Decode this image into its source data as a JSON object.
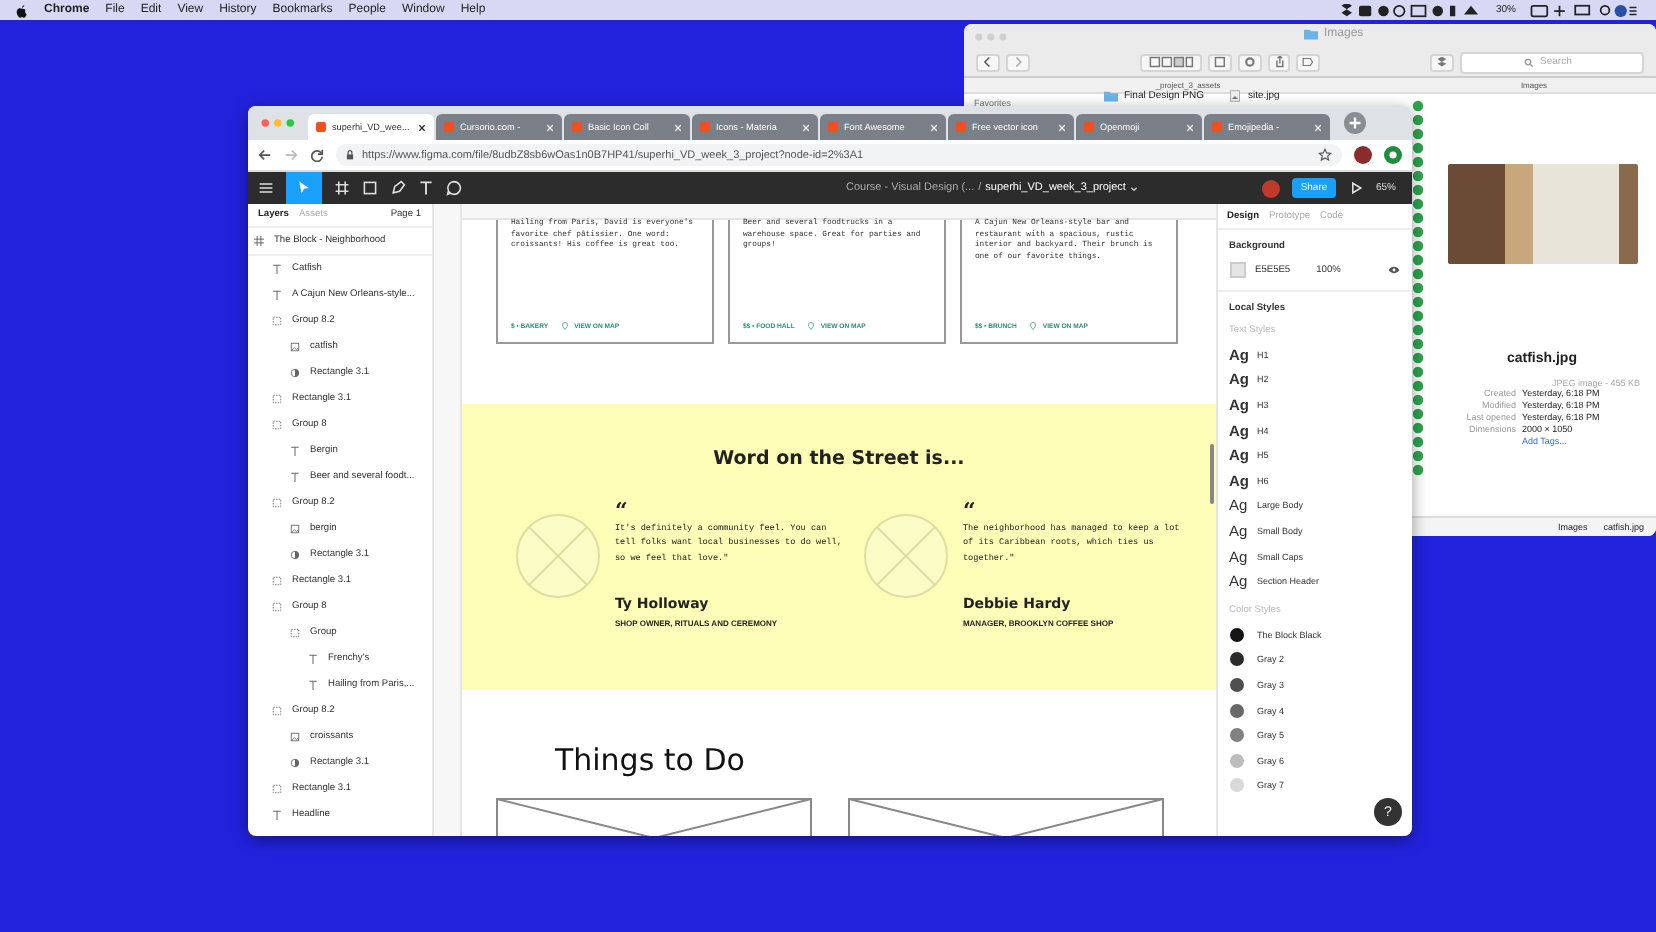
{
  "menubar": {
    "app": "Chrome",
    "items": [
      "File",
      "Edit",
      "View",
      "History",
      "Bookmarks",
      "People",
      "Window",
      "Help"
    ],
    "battery": "30%"
  },
  "finder": {
    "title": "Images",
    "search": {
      "placeholder": "Search"
    },
    "columns": [
      "_project_3_assets",
      "Images"
    ],
    "sidebar_heading": "Favorites",
    "rows": [
      {
        "name": "Final Design PNG",
        "kind": "folder"
      },
      {
        "name": "site.jpg",
        "kind": "file"
      }
    ],
    "preview": {
      "filename": "catfish.jpg",
      "type": "JPEG image - 455 KB",
      "meta": [
        {
          "label": "Created",
          "value": "Yesterday, 6:18 PM"
        },
        {
          "label": "Modified",
          "value": "Yesterday, 6:18 PM"
        },
        {
          "label": "Last opened",
          "value": "Yesterday, 6:18 PM"
        },
        {
          "label": "Dimensions",
          "value": "2000 × 1050"
        }
      ],
      "add_tags": "Add Tags..."
    },
    "path": [
      "Images",
      "catfish.jpg"
    ]
  },
  "browser": {
    "tabs": [
      {
        "title": "superhi_VD_wee...",
        "selected": true
      },
      {
        "title": "Cursorio.com -",
        "selected": false
      },
      {
        "title": "Basic Icon Coll",
        "selected": false
      },
      {
        "title": "Icons - Materia",
        "selected": false
      },
      {
        "title": "Font Awesome",
        "selected": false
      },
      {
        "title": "Free vector icon",
        "selected": false
      },
      {
        "title": "Openmoji",
        "selected": false
      },
      {
        "title": "Emojipedia -",
        "selected": false
      }
    ],
    "url": "https://www.figma.com/file/8udbZ8sb6wOas1n0B7HP41/superhi_VD_week_3_project?node-id=2%3A1"
  },
  "figma": {
    "breadcrumb": "Course - Visual Design (...",
    "separator": "/",
    "file": "superhi_VD_week_3_project",
    "share": "Share",
    "zoom": "65%",
    "layer_tabs": [
      {
        "label": "Layers",
        "selected": true
      },
      {
        "label": "Assets",
        "selected": false
      }
    ],
    "page": "Page 1",
    "frame": "The Block - Neighborhood",
    "layers": [
      {
        "name": "Catfish",
        "kind": "text"
      },
      {
        "name": "A Cajun New Orleans-style...",
        "kind": "text"
      },
      {
        "name": "Group 8.2",
        "kind": "group",
        "children": [
          {
            "name": "catfish",
            "kind": "image"
          },
          {
            "name": "Rectangle 3.1",
            "kind": "mask"
          }
        ]
      },
      {
        "name": "Rectangle 3.1",
        "kind": "group"
      },
      {
        "name": "Group 8",
        "kind": "group",
        "children": [
          {
            "name": "Bergin",
            "kind": "text"
          },
          {
            "name": "Beer and several foodt...",
            "kind": "text"
          }
        ]
      },
      {
        "name": "Group 8.2",
        "kind": "group",
        "children": [
          {
            "name": "bergin",
            "kind": "image"
          },
          {
            "name": "Rectangle 3.1",
            "kind": "mask"
          }
        ]
      },
      {
        "name": "Rectangle 3.1",
        "kind": "group"
      },
      {
        "name": "Group 8",
        "kind": "group",
        "children": [
          {
            "name": "Group",
            "kind": "group",
            "children": [
              {
                "name": "Frenchy's",
                "kind": "text"
              },
              {
                "name": "Hailing from Paris,...",
                "kind": "text"
              }
            ]
          }
        ]
      },
      {
        "name": "Group 8.2",
        "kind": "group",
        "children": [
          {
            "name": "croissants",
            "kind": "image"
          },
          {
            "name": "Rectangle 3.1",
            "kind": "mask"
          }
        ]
      },
      {
        "name": "Rectangle 3.1",
        "kind": "group"
      },
      {
        "name": "Headline",
        "kind": "text"
      }
    ]
  },
  "canvas": {
    "cards": [
      {
        "text": "Hailing from Paris, David is everyone's favorite chef pâtissier. One word: croissants! His coffee is great too.",
        "tag": "$ • BAKERY",
        "map": "VIEW ON MAP"
      },
      {
        "text": "Beer and several foodtrucks in a warehouse space. Great for parties and groups!",
        "tag": "$$ • FOOD HALL",
        "map": "VIEW ON MAP"
      },
      {
        "text": "A Cajun New Orleans-style bar and restaurant with a spacious, rustic interior and backyard. Their brunch is one of our favorite things.",
        "tag": "$$ • BRUNCH",
        "map": "VIEW ON MAP"
      }
    ],
    "testimonials": {
      "heading": "Word on the Street is...",
      "quotes": [
        {
          "mark": "“",
          "text": "It's definitely a community feel. You can tell folks want local businesses to do well, so we feel that love.\"",
          "name": "Ty Holloway",
          "role": "SHOP OWNER, RITUALS AND CEREMONY"
        },
        {
          "mark": "“",
          "text": "The neighborhood has managed to keep a lot of its Caribbean roots, which ties us together.\"",
          "name": "Debbie Hardy",
          "role": "MANAGER, BROOKLYN COFFEE SHOP"
        }
      ]
    },
    "things_heading": "Things to Do"
  },
  "design_panel": {
    "tabs": [
      {
        "label": "Design",
        "selected": true
      },
      {
        "label": "Prototype",
        "selected": false
      },
      {
        "label": "Code",
        "selected": false
      }
    ],
    "background": {
      "heading": "Background",
      "hex": "E5E5E5",
      "opacity": "100%"
    },
    "local_styles": "Local Styles",
    "text_styles_heading": "Text Styles",
    "text_styles": [
      {
        "sample": "Ag",
        "name": "H1",
        "bold": true
      },
      {
        "sample": "Ag",
        "name": "H2",
        "bold": true
      },
      {
        "sample": "Ag",
        "name": "H3",
        "bold": true
      },
      {
        "sample": "Ag",
        "name": "H4",
        "bold": true
      },
      {
        "sample": "Ag",
        "name": "H5",
        "bold": true
      },
      {
        "sample": "Ag",
        "name": "H6",
        "bold": true
      },
      {
        "sample": "Ag",
        "name": "Large Body",
        "bold": false
      },
      {
        "sample": "Ag",
        "name": "Small Body",
        "bold": false
      },
      {
        "sample": "Ag",
        "name": "Small Caps",
        "bold": false
      },
      {
        "sample": "Ag",
        "name": "Section Header",
        "bold": false
      }
    ],
    "color_styles_heading": "Color Styles",
    "color_styles": [
      {
        "name": "The Block Black",
        "color": "#141414"
      },
      {
        "name": "Gray 2",
        "color": "#2b2b2b"
      },
      {
        "name": "Gray 3",
        "color": "#4f4f4f"
      },
      {
        "name": "Gray 4",
        "color": "#686868"
      },
      {
        "name": "Gray 5",
        "color": "#828282"
      },
      {
        "name": "Gray 6",
        "color": "#bdbdbd"
      },
      {
        "name": "Gray 7",
        "color": "#d9d9d9"
      }
    ]
  },
  "help_button": "?"
}
